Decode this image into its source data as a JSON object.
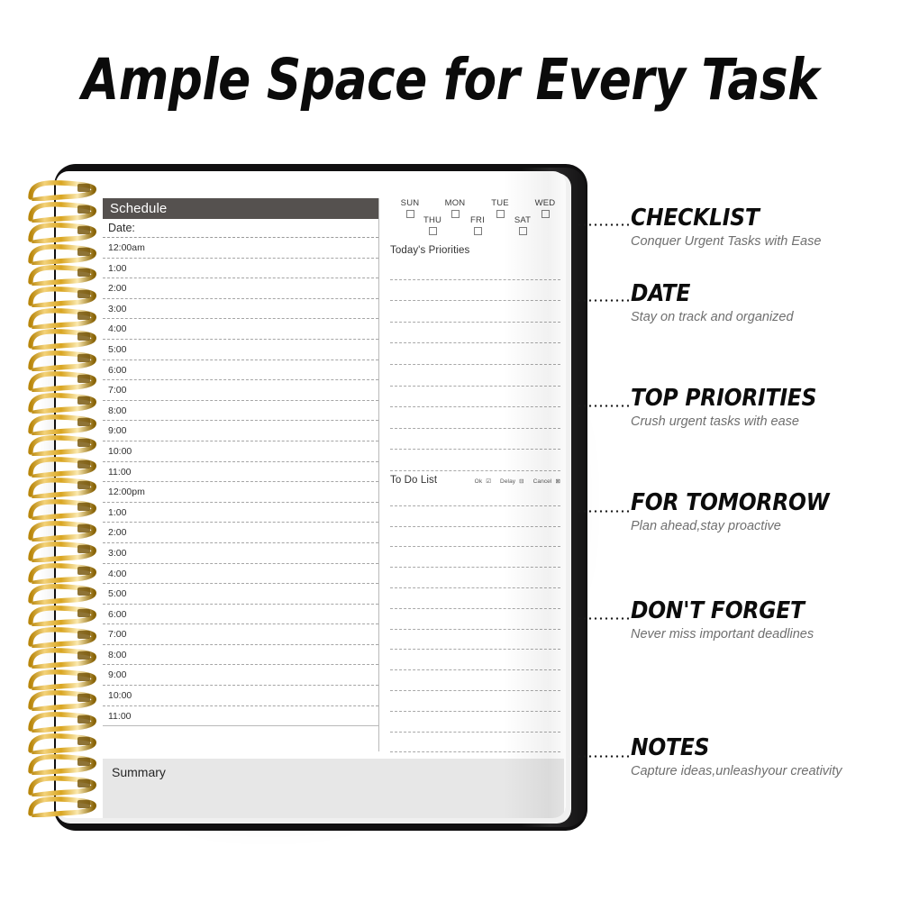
{
  "headline": "Ample Space for Every Task",
  "planner": {
    "schedule_header": "Schedule",
    "date_label": "Date:",
    "time_slots": [
      "12:00am",
      "1:00",
      "2:00",
      "3:00",
      "4:00",
      "5:00",
      "6:00",
      "7:00",
      "8:00",
      "9:00",
      "10:00",
      "11:00",
      "12:00pm",
      "1:00",
      "2:00",
      "3:00",
      "4:00",
      "5:00",
      "6:00",
      "7:00",
      "8:00",
      "9:00",
      "10:00",
      "11:00"
    ],
    "weekdays_row1": [
      "SUN",
      "MON",
      "TUE",
      "WED"
    ],
    "weekdays_row2": [
      "THU",
      "FRI",
      "SAT"
    ],
    "priorities_title": "Today's Priorities",
    "priorities_line_count": 10,
    "todo_title": "To Do List",
    "todo_legend": {
      "ok": "Ok",
      "ok_mark": "☑",
      "delay": "Delay",
      "delay_mark": "⊟",
      "cancel": "Cancel",
      "cancel_mark": "⊠"
    },
    "todo_line_count": 13,
    "summary_label": "Summary"
  },
  "annotations": [
    {
      "title": "CHECKLIST",
      "subtitle": "Conquer Urgent Tasks with Ease"
    },
    {
      "title": "DATE",
      "subtitle": "Stay on track and organized"
    },
    {
      "title": "TOP PRIORITIES",
      "subtitle": "Crush urgent tasks with ease"
    },
    {
      "title": "FOR TOMORROW",
      "subtitle": "Plan ahead,stay proactive"
    },
    {
      "title": "DON'T FORGET",
      "subtitle": "Never miss important deadlines"
    },
    {
      "title": "NOTES",
      "subtitle": "Capture ideas,unleashyour creativity"
    }
  ],
  "colors": {
    "header_bar": "#55514f",
    "summary_bg": "#e7e7e7",
    "cover": "#100f10",
    "spiral_gold": "#d8a31f",
    "subtitle_gray": "#6f6f6f"
  }
}
